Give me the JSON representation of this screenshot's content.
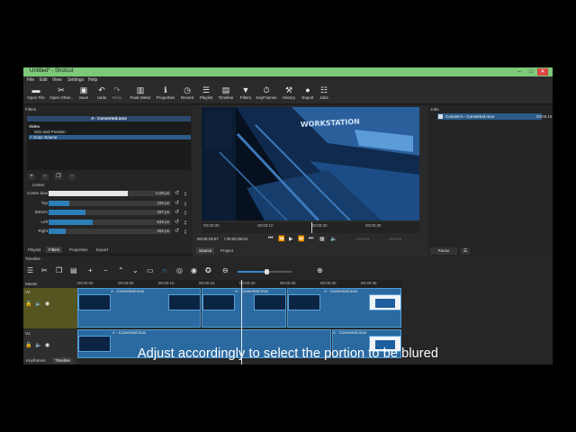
{
  "app": {
    "title": "Untitled* - Shotcut"
  },
  "window_controls": [
    "–",
    "□",
    "✕"
  ],
  "menu": [
    "File",
    "Edit",
    "View",
    "Settings",
    "Help"
  ],
  "toolbar": [
    {
      "label": "Open File",
      "icon": "folder-icon"
    },
    {
      "label": "Open Other..",
      "icon": "open-other-icon"
    },
    {
      "label": "Save",
      "icon": "save-icon"
    },
    {
      "label": "Undo",
      "icon": "undo-icon"
    },
    {
      "label": "Redo",
      "icon": "redo-icon"
    },
    {
      "label": "Peak Meter",
      "icon": "peak-meter-icon"
    },
    {
      "label": "Properties",
      "icon": "info-icon"
    },
    {
      "label": "Recent",
      "icon": "clock-icon"
    },
    {
      "label": "Playlist",
      "icon": "list-icon"
    },
    {
      "label": "Timeline",
      "icon": "timeline-icon"
    },
    {
      "label": "Filters",
      "icon": "filter-icon"
    },
    {
      "label": "KeyFrames",
      "icon": "stopwatch-icon"
    },
    {
      "label": "History",
      "icon": "history-icon"
    },
    {
      "label": "Export",
      "icon": "export-icon"
    },
    {
      "label": "Jobs",
      "icon": "jobs-icon"
    }
  ],
  "filters_panel": {
    "header": "Filters",
    "clip_title": "A - Converted.mov",
    "list": [
      {
        "label": "Video",
        "selected": false,
        "bold": true
      },
      {
        "label": "Size and Position",
        "selected": false,
        "bold": false
      },
      {
        "label": "✓ Crop: Source",
        "selected": true,
        "bold": false
      }
    ],
    "section": "Center",
    "props": [
      {
        "label": "Center bias",
        "value": "0.00 px",
        "fill": 0.65
      },
      {
        "label": "Top",
        "value": "192 px",
        "fill": 0.17
      },
      {
        "label": "Bottom",
        "value": "297 px",
        "fill": 0.3
      },
      {
        "label": "Left",
        "value": "648 px",
        "fill": 0.36
      },
      {
        "label": "Right",
        "value": "292 px",
        "fill": 0.14
      }
    ],
    "tabs": [
      "Playlist",
      "Filters",
      "Properties",
      "Export"
    ]
  },
  "player": {
    "sign_text": "WORKSTATION",
    "ruler_ticks": [
      "00:00:00",
      "00:00:10",
      "00:00:20",
      "00:00:30"
    ],
    "timecode_current": "00:00:19:07",
    "timecode_total": "/ 00:00:39:01",
    "in_marker": "--:--:--:-",
    "out_marker": "--:--:--:-",
    "tabs": [
      "Source",
      "Project"
    ]
  },
  "jobs_panel": {
    "header": "Jobs",
    "job_name": "Convert A - Converted.mov",
    "job_time": "00:00:15",
    "pause_label": "Pause",
    "menu_label": "☰"
  },
  "timeline": {
    "header": "Timeline",
    "master": "Master",
    "ruler_ticks": [
      "00:00:00",
      "00:00:05",
      "00:00:10",
      "00:00:15",
      "00:00:20",
      "00:00:25",
      "00:00:30",
      "00:00:35"
    ],
    "tracks": [
      {
        "name": "V2",
        "clips": [
          "A - Converted.mov",
          "A - Converted.mov",
          "A - Converted.mov"
        ]
      },
      {
        "name": "V1",
        "clips": [
          "A - Converted.mov",
          "A - Converted.mov"
        ]
      }
    ],
    "tabs": [
      "Keyframes",
      "Timeline"
    ]
  },
  "subtitle": "Adjust accordingly to select the portion to be blured",
  "colors": {
    "accent": "#2c5d8a",
    "clip": "#2b6aa0",
    "titlebar": "#7ec87a",
    "track_header_selected": "#555522"
  }
}
